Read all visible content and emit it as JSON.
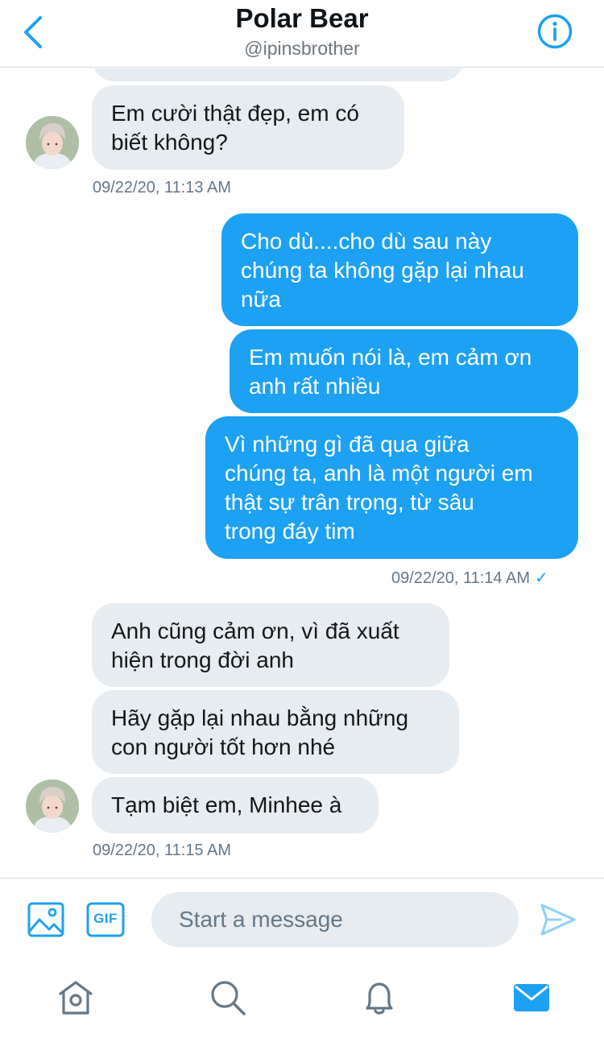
{
  "header": {
    "title": "Polar Bear",
    "handle": "@ipinsbrother",
    "back_icon": "chevron-left-icon",
    "info_icon": "info-circle-icon"
  },
  "conversation": {
    "messages": [
      {
        "direction": "incoming",
        "text": "Em cười thật đẹp, em có\nbiết không?"
      },
      {
        "direction": "outgoing",
        "text": "Cho dù....cho dù sau này\nchúng ta không gặp lại nhau\nnữa"
      },
      {
        "direction": "outgoing",
        "text": "Em muốn nói là, em cảm ơn\nanh rất nhiều"
      },
      {
        "direction": "outgoing",
        "text": "Vì những gì đã qua giữa\nchúng ta, anh là một người em\nthật sự trân trọng, từ sâu\ntrong đáy tim"
      },
      {
        "direction": "incoming",
        "text": "Anh cũng cảm ơn, vì đã xuất\nhiện trong đời anh"
      },
      {
        "direction": "incoming",
        "text": "Hãy gặp lại nhau bằng những\ncon người tốt hơn nhé"
      },
      {
        "direction": "incoming",
        "text": "Tạm biệt em, Minhee à"
      }
    ],
    "timestamps": [
      {
        "text": "09/22/20, 11:13 AM",
        "seen": false
      },
      {
        "text": "09/22/20, 11:14 AM",
        "seen": true,
        "check": "✓"
      },
      {
        "text": "09/22/20, 11:15 AM",
        "seen": false
      }
    ]
  },
  "composer": {
    "placeholder": "Start a message",
    "gif_label": "GIF",
    "media_icon": "image-icon",
    "send_icon": "send-icon"
  },
  "tabbar": {
    "items": [
      {
        "name": "home",
        "icon": "home-icon",
        "active": false
      },
      {
        "name": "search",
        "icon": "search-icon",
        "active": false
      },
      {
        "name": "notifications",
        "icon": "bell-icon",
        "active": false
      },
      {
        "name": "messages",
        "icon": "mail-icon",
        "active": true
      }
    ]
  },
  "colors": {
    "accent": "#1da1f2",
    "incoming_bubble": "#e6ecf0",
    "muted_text": "#657786",
    "divider": "#d6dadf"
  }
}
